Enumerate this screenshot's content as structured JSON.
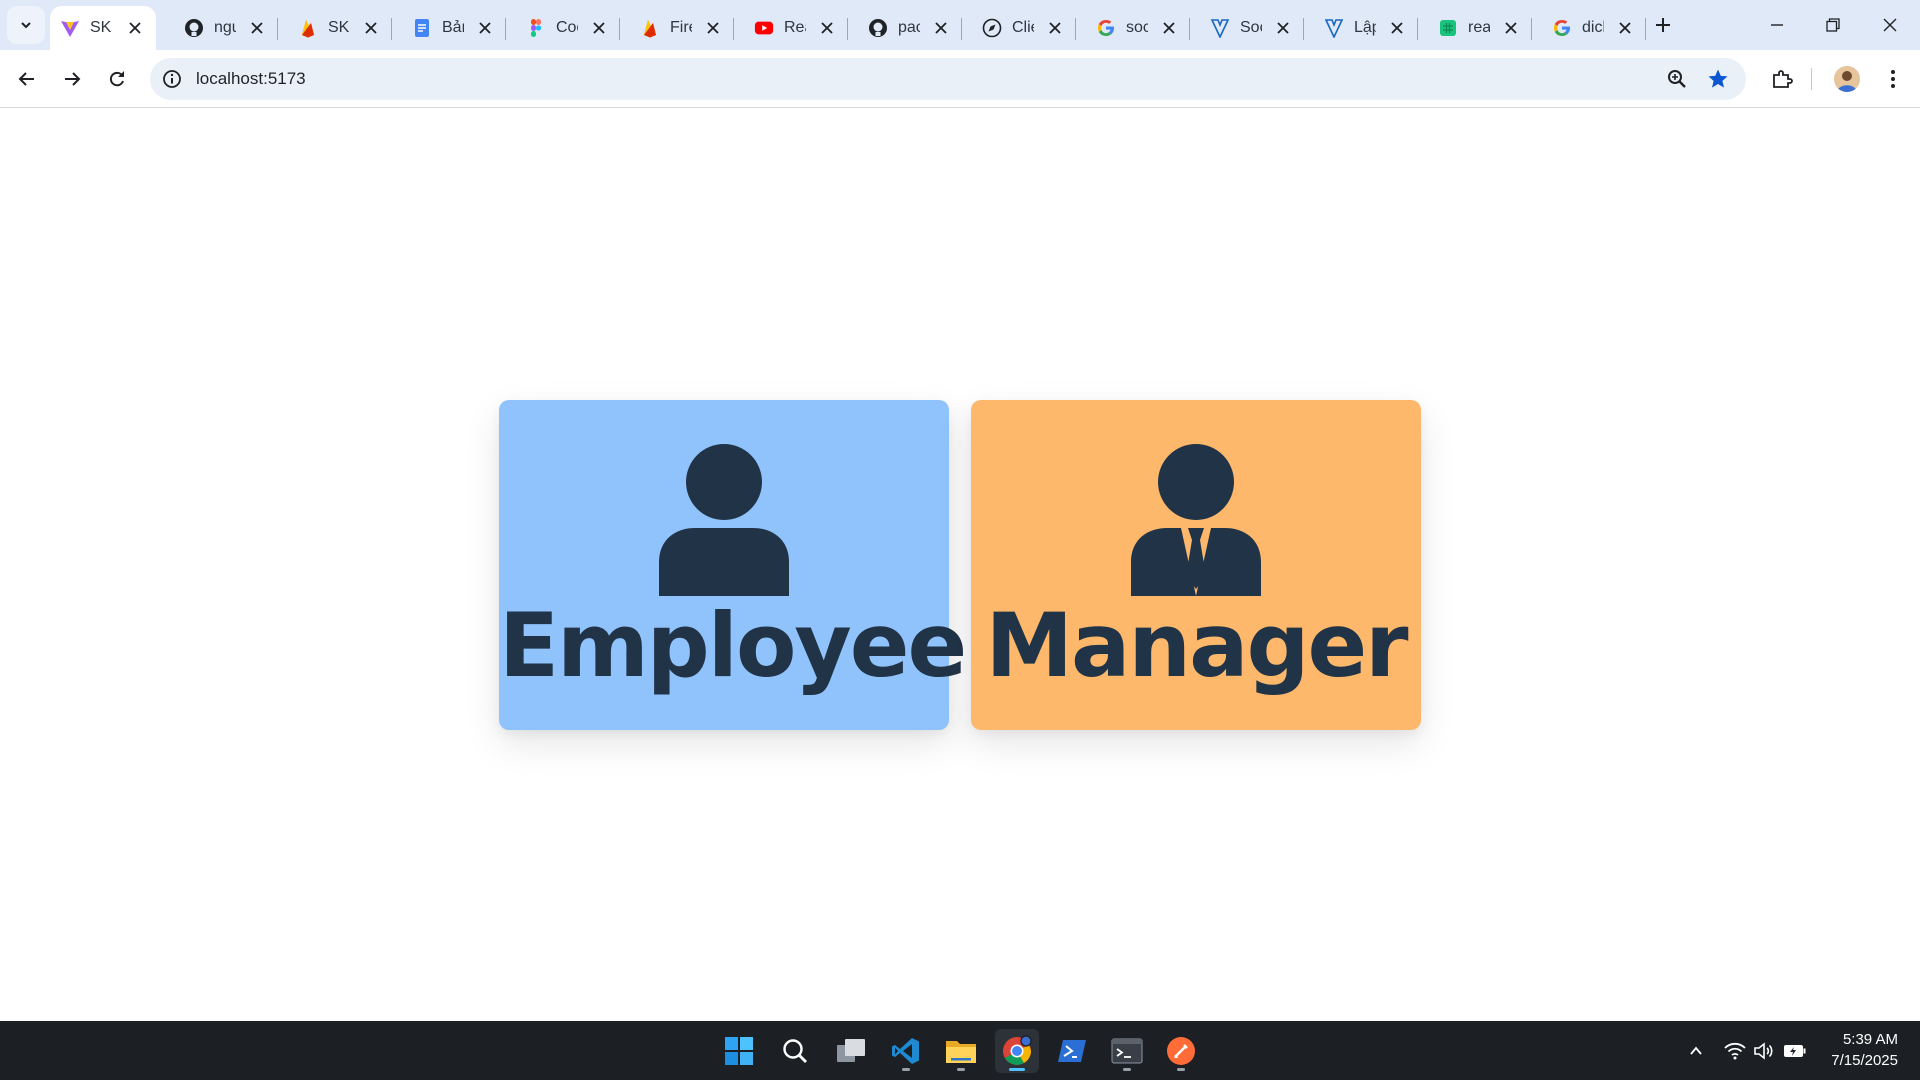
{
  "browser": {
    "tabs": [
      {
        "title": "SKIF",
        "icon": "vite-icon",
        "active": true
      },
      {
        "title": "ngu",
        "icon": "github-icon"
      },
      {
        "title": "SKIF",
        "icon": "firebase-icon"
      },
      {
        "title": "Bản",
        "icon": "docs-icon"
      },
      {
        "title": "Cod",
        "icon": "figma-icon"
      },
      {
        "title": "Fire",
        "icon": "firebase-icon"
      },
      {
        "title": "Rea",
        "icon": "youtube-icon"
      },
      {
        "title": "pac",
        "icon": "github-icon"
      },
      {
        "title": "Clie",
        "icon": "compass-icon"
      },
      {
        "title": "soc",
        "icon": "google-icon"
      },
      {
        "title": "Soc",
        "icon": "vuetify-icon"
      },
      {
        "title": "Lập",
        "icon": "vuetify-icon"
      },
      {
        "title": "rea",
        "icon": "sheets-icon"
      },
      {
        "title": "dich",
        "icon": "google-icon"
      }
    ],
    "url": "localhost:5173"
  },
  "roles": {
    "employee": {
      "label": "Employee",
      "icon": "person-icon",
      "color": "#90c3fb"
    },
    "manager": {
      "label": "Manager",
      "icon": "businessman-icon",
      "color": "#fdb86b"
    }
  },
  "taskbar": {
    "time": "5:39 AM",
    "date": "7/15/2025"
  }
}
